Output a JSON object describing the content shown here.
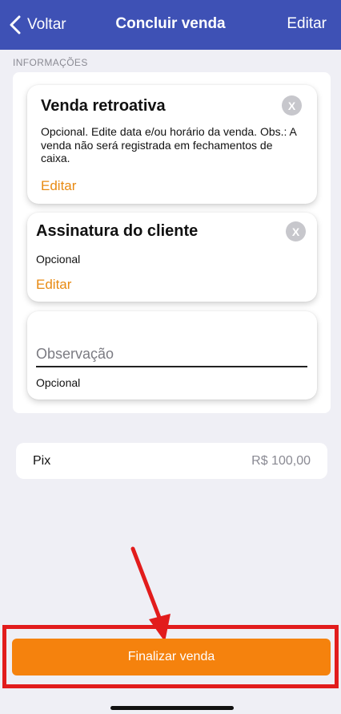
{
  "header": {
    "back_label": "Voltar",
    "title": "Concluir venda",
    "edit_label": "Editar",
    "background_color": "#3e51b5"
  },
  "section_label": "INFORMAÇÕES",
  "retroactive_sale": {
    "title": "Venda retroativa",
    "description": "Opcional. Edite data e/ou horário da venda. Obs.: A venda não será registrada em fechamentos de caixa.",
    "edit_link": "Editar",
    "close_icon": "X"
  },
  "customer_signature": {
    "title": "Assinatura do cliente",
    "description": "Opcional",
    "edit_link": "Editar",
    "close_icon": "X"
  },
  "observation": {
    "placeholder": "Observação",
    "value": "",
    "helper": "Opcional"
  },
  "payment": {
    "method": "Pix",
    "amount": "R$ 100,00"
  },
  "finalize_button": {
    "label": "Finalizar venda",
    "color": "#f5820d"
  },
  "annotation": {
    "highlight_color": "#e21c1c"
  },
  "icons": [
    "chevron-left-icon",
    "close-icon",
    "annotation-arrow-icon"
  ]
}
